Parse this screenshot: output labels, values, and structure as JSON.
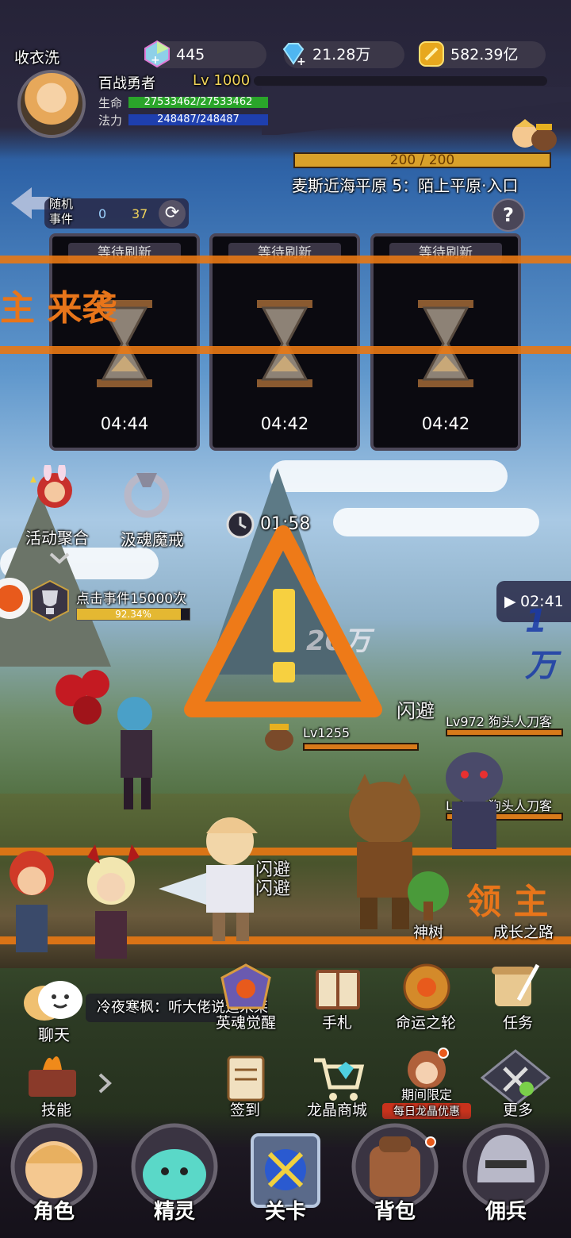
{
  "player": {
    "name": "收衣洗",
    "title": "百战勇者",
    "level": "Lv 1000",
    "hp_label": "生命",
    "hp": "27533462/27533462",
    "mp_label": "法力",
    "mp": "248487/248487"
  },
  "resources": {
    "crystal": "445",
    "diamond": "21.28万",
    "gold": "582.39亿"
  },
  "stage": {
    "progress": "200 / 200",
    "location": "麦斯近海平原 5：陌上平原·入口"
  },
  "random_event": {
    "label_line1": "随机",
    "label_line2": "事件",
    "count_a": "0",
    "count_b": "37",
    "help": "?"
  },
  "event_cards": [
    {
      "header": "等待刷新",
      "timer": "04:44"
    },
    {
      "header": "等待刷新",
      "timer": "04:42"
    },
    {
      "header": "等待刷新",
      "timer": "04:42"
    }
  ],
  "boss_banner": {
    "left": "主 来袭",
    "right": "领 主"
  },
  "side_left": {
    "activity": "活动聚合",
    "ring": "汲魂魔戒",
    "event_task": "点击事件15000次",
    "event_task_progress": "92.34%"
  },
  "timers": {
    "center": "01:58",
    "right": "02:41"
  },
  "combat": {
    "floating_texts": [
      "闪避",
      "闪避",
      "闪避",
      "1万",
      "20万"
    ],
    "boss_level": "Lv1255",
    "enemy1": "Lv972 狗头人刀客",
    "enemy2": "Lv972 狗头人刀客"
  },
  "right_icons": {
    "tree": "神树",
    "growth": "成长之路"
  },
  "chat": {
    "label": "聊天",
    "message": "冷夜寒枫：听大佬说迪米莱尔"
  },
  "functions": {
    "awaken": "英魂觉醒",
    "manual": "手札",
    "wheel": "命运之轮",
    "task": "任务",
    "skill": "技能",
    "signin": "签到",
    "shop": "龙晶商城",
    "limited_line1": "期间限定",
    "limited_line2": "每日龙晶优惠",
    "more": "更多"
  },
  "nav": {
    "role": "角色",
    "spirit": "精灵",
    "stage": "关卡",
    "bag": "背包",
    "merc": "佣兵"
  },
  "colors": {
    "accent_orange": "#e8781a",
    "hp_green": "#2aa52a",
    "mp_blue": "#1e3fae",
    "gold_text": "#f0d45a",
    "notification_red": "#e85a1c"
  }
}
